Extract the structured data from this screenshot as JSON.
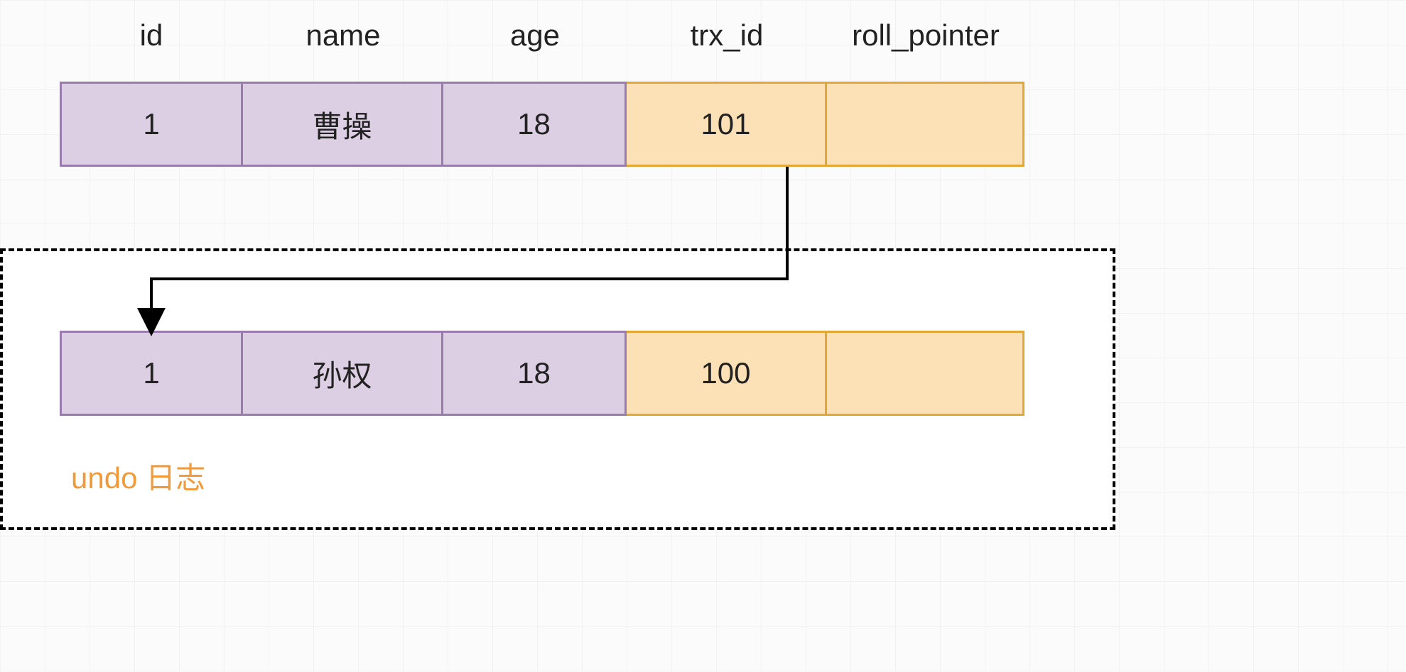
{
  "headers": {
    "id": "id",
    "name": "name",
    "age": "age",
    "trx_id": "trx_id",
    "roll_pointer": "roll_pointer"
  },
  "current_row": {
    "id": "1",
    "name": "曹操",
    "age": "18",
    "trx_id": "101",
    "roll_pointer": ""
  },
  "undo_row": {
    "id": "1",
    "name": "孙权",
    "age": "18",
    "trx_id": "100",
    "roll_pointer": ""
  },
  "undo_label": "undo 日志",
  "colors": {
    "purple_fill": "#dccee3",
    "purple_border": "#9a7bad",
    "orange_fill": "#fce0b6",
    "orange_border": "#e3a736",
    "label_orange": "#f09a3a"
  }
}
